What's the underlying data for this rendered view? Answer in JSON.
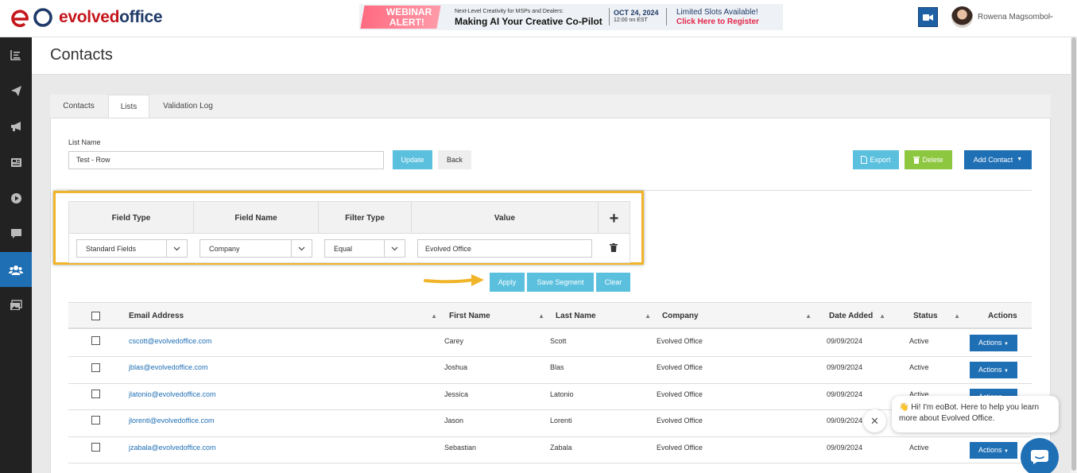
{
  "header": {
    "logo": {
      "part1": "evolved",
      "part2": "office"
    },
    "banner": {
      "badge": "WEBINAR ALERT!",
      "tagline": "Next-Level Creativity for MSPs and Dealers:",
      "headline": "Making AI Your Creative Co-Pilot",
      "date": "OCT 24, 2024",
      "time": "12:00 nn EST",
      "slots": "Limited Slots Available!",
      "register": "Click Here to Register"
    },
    "user_name": "Rowena Magsombol"
  },
  "sidebar": {
    "items": [
      {
        "icon": "dashboard-icon"
      },
      {
        "icon": "paper-plane-icon"
      },
      {
        "icon": "megaphone-icon"
      },
      {
        "icon": "newspaper-icon"
      },
      {
        "icon": "play-circle-icon"
      },
      {
        "icon": "chat-icon"
      },
      {
        "icon": "users-icon",
        "active": true
      },
      {
        "icon": "images-icon"
      }
    ],
    "active_color": "#1f6fb5"
  },
  "page": {
    "title": "Contacts"
  },
  "tabs": [
    {
      "label": "Contacts"
    },
    {
      "label": "Lists",
      "active": true
    },
    {
      "label": "Validation Log"
    }
  ],
  "list_form": {
    "label": "List Name",
    "value": "Test - Row",
    "update_label": "Update",
    "back_label": "Back"
  },
  "toolbar": {
    "export_label": "Export",
    "delete_label": "Delete",
    "add_contact_label": "Add Contact"
  },
  "filter": {
    "headers": [
      "Field Type",
      "Field Name",
      "Filter Type",
      "Value"
    ],
    "add_symbol": "+",
    "row": {
      "field_type": "Standard Fields",
      "field_name": "Company",
      "filter_type": "Equal",
      "value": "Evolved Office"
    },
    "apply_label": "Apply",
    "save_segment_label": "Save Segment",
    "clear_label": "Clear",
    "highlight_color": "#f0b429"
  },
  "table": {
    "columns": [
      "Email Address",
      "First Name",
      "Last Name",
      "Company",
      "Date Added",
      "Status",
      "Actions"
    ],
    "actions_label": "Actions",
    "rows": [
      {
        "email": "cscott@evolvedoffice.com",
        "first": "Carey",
        "last": "Scott",
        "company": "Evolved Office",
        "date": "09/09/2024",
        "status": "Active"
      },
      {
        "email": "jblas@evolvedoffice.com",
        "first": "Joshua",
        "last": "Blas",
        "company": "Evolved Office",
        "date": "09/09/2024",
        "status": "Active"
      },
      {
        "email": "jlatonio@evolvedoffice.com",
        "first": "Jessica",
        "last": "Latonio",
        "company": "Evolved Office",
        "date": "09/09/2024",
        "status": "Active"
      },
      {
        "email": "jlorenti@evolvedoffice.com",
        "first": "Jason",
        "last": "Lorenti",
        "company": "Evolved Office",
        "date": "09/09/2024",
        "status": "Active"
      },
      {
        "email": "jzabala@evolvedoffice.com",
        "first": "Sebastian",
        "last": "Zabala",
        "company": "Evolved Office",
        "date": "09/09/2024",
        "status": "Active"
      }
    ]
  },
  "chat": {
    "message": "👋 Hi! I'm eoBot. Here to help you learn more about Evolved Office.",
    "close_symbol": "✕"
  }
}
